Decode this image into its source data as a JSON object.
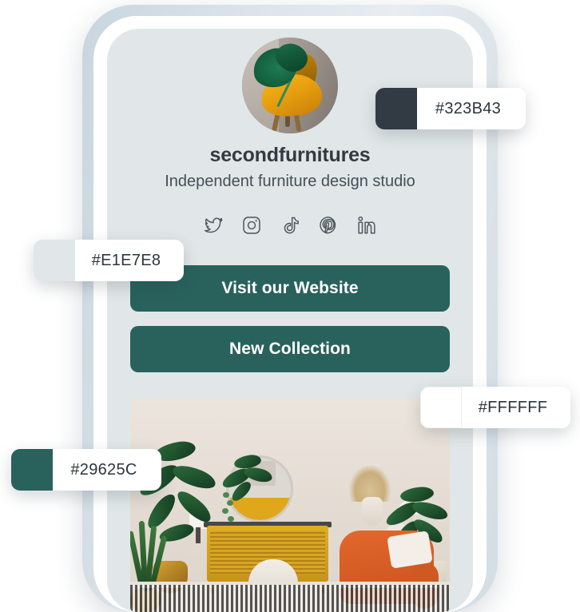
{
  "phone": {
    "profile": {
      "avatar_alt": "yellow-chair-with-monstera-leaf",
      "name": "secondfurnitures",
      "bio": "Independent furniture design studio",
      "socials": [
        {
          "name": "twitter-icon",
          "label": "Twitter"
        },
        {
          "name": "instagram-icon",
          "label": "Instagram"
        },
        {
          "name": "tiktok-icon",
          "label": "TikTok"
        },
        {
          "name": "pinterest-icon",
          "label": "Pinterest"
        },
        {
          "name": "linkedin-icon",
          "label": "LinkedIn"
        }
      ]
    },
    "buttons": [
      {
        "label": "Visit our Website"
      },
      {
        "label": "New Collection"
      }
    ],
    "media": {
      "alt": "living-room-interior-with-plants-yellow-sideboard-and-orange-armchair"
    },
    "screen_background": "#E1E7E8"
  },
  "swatches": [
    {
      "id": "dark",
      "hex": "#323B43",
      "color": "#323B43"
    },
    {
      "id": "light",
      "hex": "#E1E7E8",
      "color": "#E1E7E8"
    },
    {
      "id": "white",
      "hex": "#FFFFFF",
      "color": "#FFFFFF"
    },
    {
      "id": "green",
      "hex": "#29625C",
      "color": "#29625C"
    }
  ]
}
